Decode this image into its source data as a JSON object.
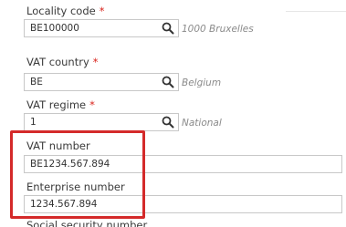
{
  "fields": [
    {
      "label": "Locality code",
      "required": "*",
      "value": "BE100000",
      "hint": "1000 Bruxelles"
    },
    {
      "label": "VAT country",
      "required": "*",
      "value": "BE",
      "hint": "Belgium"
    },
    {
      "label": "VAT regime",
      "required": "*",
      "value": "1",
      "hint": "National"
    },
    {
      "label": "VAT number",
      "value": "BE1234.567.894"
    },
    {
      "label": "Enterprise number",
      "value": "1234.567.894"
    },
    {
      "label": "Social security number"
    }
  ],
  "icons": {
    "lookup": "search-icon"
  },
  "colors": {
    "required": "#d9241c",
    "highlight": "#d42a2a"
  }
}
